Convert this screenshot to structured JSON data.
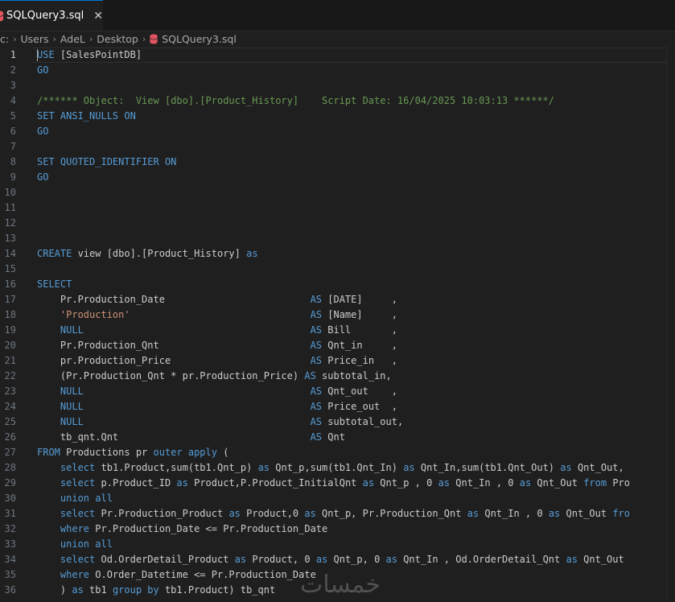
{
  "tab": {
    "title": "SQLQuery3.sql",
    "close": "✕"
  },
  "breadcrumb": [
    "c:",
    "Users",
    "AdeL",
    "Desktop",
    "SQLQuery3.sql"
  ],
  "lines": [
    {
      "n": "1",
      "segs": [
        [
          "kw",
          "USE"
        ],
        [
          "plain",
          " [SalesPointDB]"
        ]
      ]
    },
    {
      "n": "2",
      "segs": [
        [
          "kw",
          "GO"
        ]
      ]
    },
    {
      "n": "3",
      "segs": []
    },
    {
      "n": "4",
      "segs": [
        [
          "cmt",
          "/****** Object:  View [dbo].[Product_History]    Script Date: 16/04/2025 10:03:13 ******/"
        ]
      ]
    },
    {
      "n": "5",
      "segs": [
        [
          "kw",
          "SET ANSI_NULLS ON"
        ]
      ]
    },
    {
      "n": "6",
      "segs": [
        [
          "kw",
          "GO"
        ]
      ]
    },
    {
      "n": "7",
      "segs": []
    },
    {
      "n": "8",
      "segs": [
        [
          "kw",
          "SET QUOTED_IDENTIFIER ON"
        ]
      ]
    },
    {
      "n": "9",
      "segs": [
        [
          "kw",
          "GO"
        ]
      ]
    },
    {
      "n": "10",
      "segs": []
    },
    {
      "n": "11",
      "segs": []
    },
    {
      "n": "12",
      "segs": []
    },
    {
      "n": "13",
      "segs": []
    },
    {
      "n": "14",
      "segs": [
        [
          "kw",
          "CREATE"
        ],
        [
          "plain",
          " view [dbo].[Product_History] "
        ],
        [
          "kw",
          "as"
        ]
      ]
    },
    {
      "n": "15",
      "segs": []
    },
    {
      "n": "16",
      "segs": [
        [
          "kw",
          "SELECT"
        ]
      ]
    },
    {
      "n": "17",
      "segs": [
        [
          "plain",
          "    Pr.Production_Date                         "
        ],
        [
          "kw",
          "AS"
        ],
        [
          "plain",
          " [DATE]     ,"
        ]
      ]
    },
    {
      "n": "18",
      "segs": [
        [
          "plain",
          "    "
        ],
        [
          "str",
          "'Production'"
        ],
        [
          "plain",
          "                               "
        ],
        [
          "kw",
          "AS"
        ],
        [
          "plain",
          " [Name]     ,"
        ]
      ]
    },
    {
      "n": "19",
      "segs": [
        [
          "plain",
          "    "
        ],
        [
          "kw",
          "NULL"
        ],
        [
          "plain",
          "                                       "
        ],
        [
          "kw",
          "AS"
        ],
        [
          "plain",
          " Bill       ,"
        ]
      ]
    },
    {
      "n": "20",
      "segs": [
        [
          "plain",
          "    Pr.Production_Qnt                          "
        ],
        [
          "kw",
          "AS"
        ],
        [
          "plain",
          " Qnt_in     ,"
        ]
      ]
    },
    {
      "n": "21",
      "segs": [
        [
          "plain",
          "    pr.Production_Price                        "
        ],
        [
          "kw",
          "AS"
        ],
        [
          "plain",
          " Price_in   ,"
        ]
      ]
    },
    {
      "n": "22",
      "segs": [
        [
          "plain",
          "    (Pr.Production_Qnt * pr.Production_Price) "
        ],
        [
          "kw",
          "AS"
        ],
        [
          "plain",
          " subtotal_in,"
        ]
      ]
    },
    {
      "n": "23",
      "segs": [
        [
          "plain",
          "    "
        ],
        [
          "kw",
          "NULL"
        ],
        [
          "plain",
          "                                       "
        ],
        [
          "kw",
          "AS"
        ],
        [
          "plain",
          " Qnt_out    ,"
        ]
      ]
    },
    {
      "n": "24",
      "segs": [
        [
          "plain",
          "    "
        ],
        [
          "kw",
          "NULL"
        ],
        [
          "plain",
          "                                       "
        ],
        [
          "kw",
          "AS"
        ],
        [
          "plain",
          " Price_out  ,"
        ]
      ]
    },
    {
      "n": "25",
      "segs": [
        [
          "plain",
          "    "
        ],
        [
          "kw",
          "NULL"
        ],
        [
          "plain",
          "                                       "
        ],
        [
          "kw",
          "AS"
        ],
        [
          "plain",
          " subtotal_out,"
        ]
      ]
    },
    {
      "n": "26",
      "segs": [
        [
          "plain",
          "    tb_qnt.Qnt                                 "
        ],
        [
          "kw",
          "AS"
        ],
        [
          "plain",
          " Qnt"
        ]
      ]
    },
    {
      "n": "27",
      "segs": [
        [
          "kw",
          "FROM"
        ],
        [
          "plain",
          " Productions pr "
        ],
        [
          "kw",
          "outer apply"
        ],
        [
          "plain",
          " ("
        ]
      ]
    },
    {
      "n": "28",
      "segs": [
        [
          "plain",
          "    "
        ],
        [
          "kw",
          "select"
        ],
        [
          "plain",
          " tb1.Product,sum(tb1.Qnt_p) "
        ],
        [
          "kw",
          "as"
        ],
        [
          "plain",
          " Qnt_p,sum(tb1.Qnt_In) "
        ],
        [
          "kw",
          "as"
        ],
        [
          "plain",
          " Qnt_In,sum(tb1.Qnt_Out) "
        ],
        [
          "kw",
          "as"
        ],
        [
          "plain",
          " Qnt_Out,"
        ]
      ]
    },
    {
      "n": "29",
      "segs": [
        [
          "plain",
          "    "
        ],
        [
          "kw",
          "select"
        ],
        [
          "plain",
          " p.Product_ID "
        ],
        [
          "kw",
          "as"
        ],
        [
          "plain",
          " Product,P.Product_InitialQnt "
        ],
        [
          "kw",
          "as"
        ],
        [
          "plain",
          " Qnt_p , 0 "
        ],
        [
          "kw",
          "as"
        ],
        [
          "plain",
          " Qnt_In , 0 "
        ],
        [
          "kw",
          "as"
        ],
        [
          "plain",
          " Qnt_Out "
        ],
        [
          "kw",
          "from"
        ],
        [
          "plain",
          " Pro"
        ]
      ]
    },
    {
      "n": "30",
      "segs": [
        [
          "plain",
          "    "
        ],
        [
          "kw",
          "union all"
        ]
      ]
    },
    {
      "n": "31",
      "segs": [
        [
          "plain",
          "    "
        ],
        [
          "kw",
          "select"
        ],
        [
          "plain",
          " Pr.Production_Product "
        ],
        [
          "kw",
          "as"
        ],
        [
          "plain",
          " Product,0 "
        ],
        [
          "kw",
          "as"
        ],
        [
          "plain",
          " Qnt_p, Pr.Production_Qnt "
        ],
        [
          "kw",
          "as"
        ],
        [
          "plain",
          " Qnt_In , 0 "
        ],
        [
          "kw",
          "as"
        ],
        [
          "plain",
          " Qnt_Out "
        ],
        [
          "kw",
          "fro"
        ]
      ]
    },
    {
      "n": "32",
      "segs": [
        [
          "plain",
          "    "
        ],
        [
          "kw",
          "where"
        ],
        [
          "plain",
          " Pr.Production_Date <= Pr.Production_Date"
        ]
      ]
    },
    {
      "n": "33",
      "segs": [
        [
          "plain",
          "    "
        ],
        [
          "kw",
          "union all"
        ]
      ]
    },
    {
      "n": "34",
      "segs": [
        [
          "plain",
          "    "
        ],
        [
          "kw",
          "select"
        ],
        [
          "plain",
          " Od.OrderDetail_Product "
        ],
        [
          "kw",
          "as"
        ],
        [
          "plain",
          " Product, 0 "
        ],
        [
          "kw",
          "as"
        ],
        [
          "plain",
          " Qnt_p, 0 "
        ],
        [
          "kw",
          "as"
        ],
        [
          "plain",
          " Qnt_In , Od.OrderDetail_Qnt "
        ],
        [
          "kw",
          "as"
        ],
        [
          "plain",
          " Qnt_Out"
        ]
      ]
    },
    {
      "n": "35",
      "segs": [
        [
          "plain",
          "    "
        ],
        [
          "kw",
          "where"
        ],
        [
          "plain",
          " O.Order_Datetime <= Pr.Production_Date"
        ]
      ]
    },
    {
      "n": "36",
      "segs": [
        [
          "plain",
          "    ) "
        ],
        [
          "kw",
          "as"
        ],
        [
          "plain",
          " tb1 "
        ],
        [
          "kw",
          "group by"
        ],
        [
          "plain",
          " tb1.Product) tb_qnt"
        ]
      ]
    }
  ],
  "watermark": "خمسات"
}
